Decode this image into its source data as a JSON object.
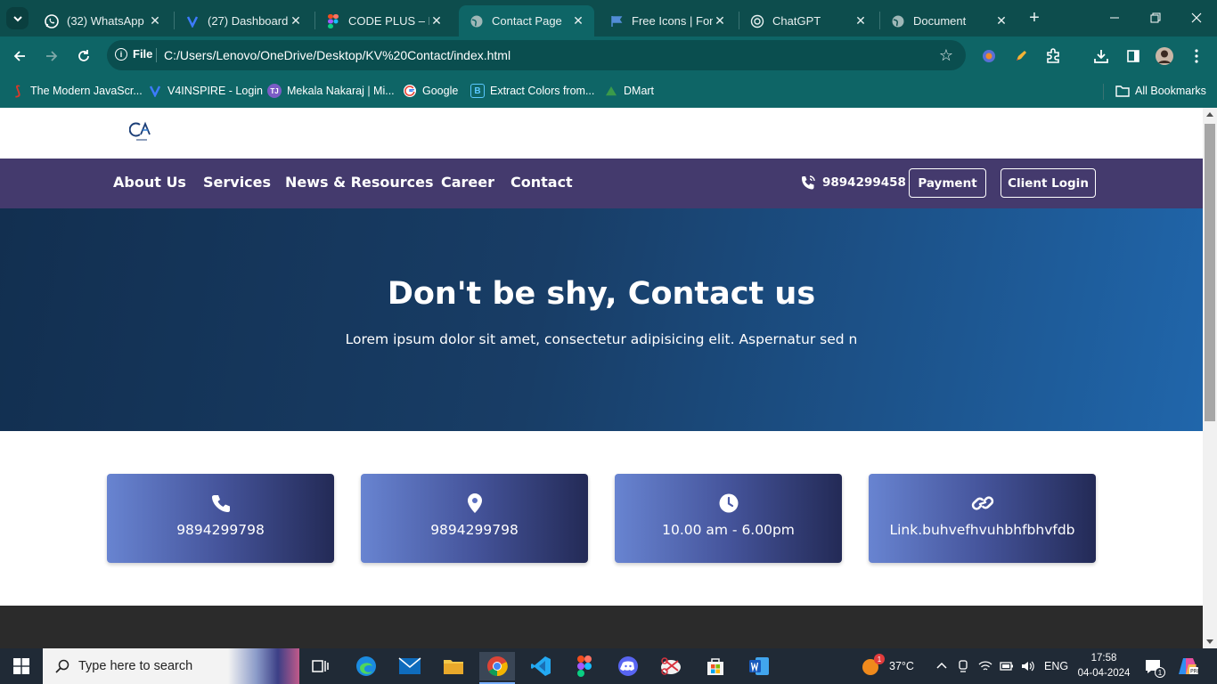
{
  "browser": {
    "tabs": [
      {
        "title": "(32) WhatsApp",
        "icon": "whatsapp-icon"
      },
      {
        "title": "(27) Dashboard",
        "icon": "v-logo-icon"
      },
      {
        "title": "CODE PLUS – Fig",
        "icon": "figma-icon"
      },
      {
        "title": "Contact Page",
        "icon": "globe-icon",
        "active": true
      },
      {
        "title": "Free Icons | Font",
        "icon": "flag-icon"
      },
      {
        "title": "ChatGPT",
        "icon": "chatgpt-icon"
      },
      {
        "title": "Document",
        "icon": "globe-icon"
      }
    ],
    "address": {
      "scheme_label": "File",
      "url": "C:/Users/Lenovo/OneDrive/Desktop/KV%20Contact/index.html"
    },
    "bookmarks": [
      {
        "label": "The Modern JavaScr...",
        "icon": "js-icon"
      },
      {
        "label": "V4INSPIRE - Login",
        "icon": "v-logo-icon"
      },
      {
        "label": "Mekala Nakaraj | Mi...",
        "icon": "profile-icon"
      },
      {
        "label": "Google",
        "icon": "google-icon"
      },
      {
        "label": "Extract Colors from...",
        "icon": "b-icon"
      },
      {
        "label": "DMart",
        "icon": "dmart-icon"
      }
    ],
    "all_bookmarks_label": "All Bookmarks",
    "colors": {
      "frame": "#0d4d4d",
      "toolbar": "#0e6566"
    }
  },
  "site": {
    "nav": {
      "links": [
        "About Us",
        "Services",
        "News & Resources",
        "Career",
        "Contact"
      ],
      "phone": "9894299458",
      "payment_label": "Payment",
      "client_login_label": "Client Login"
    },
    "hero": {
      "title": "Don't be shy, Contact us",
      "subtitle": "Lorem ipsum dolor sit amet, consectetur adipisicing elit. Aspernatur sed n"
    },
    "cards": [
      {
        "icon": "phone-icon",
        "text": "9894299798"
      },
      {
        "icon": "location-pin-icon",
        "text": "9894299798"
      },
      {
        "icon": "clock-icon",
        "text": "10.00 am - 6.00pm"
      },
      {
        "icon": "link-icon",
        "text": "Link.buhvefhvuhbhfbhvfdb"
      }
    ],
    "colors": {
      "navbar": "#443a6d",
      "hero_start": "#122f50",
      "hero_end": "#2066ab",
      "footer": "#2b2b2b"
    }
  },
  "taskbar": {
    "search_placeholder": "Type here to search",
    "weather": "37°C",
    "weather_badge": "1",
    "language": "ENG",
    "time": "17:58",
    "date": "04-04-2024",
    "notification_count": "1"
  }
}
